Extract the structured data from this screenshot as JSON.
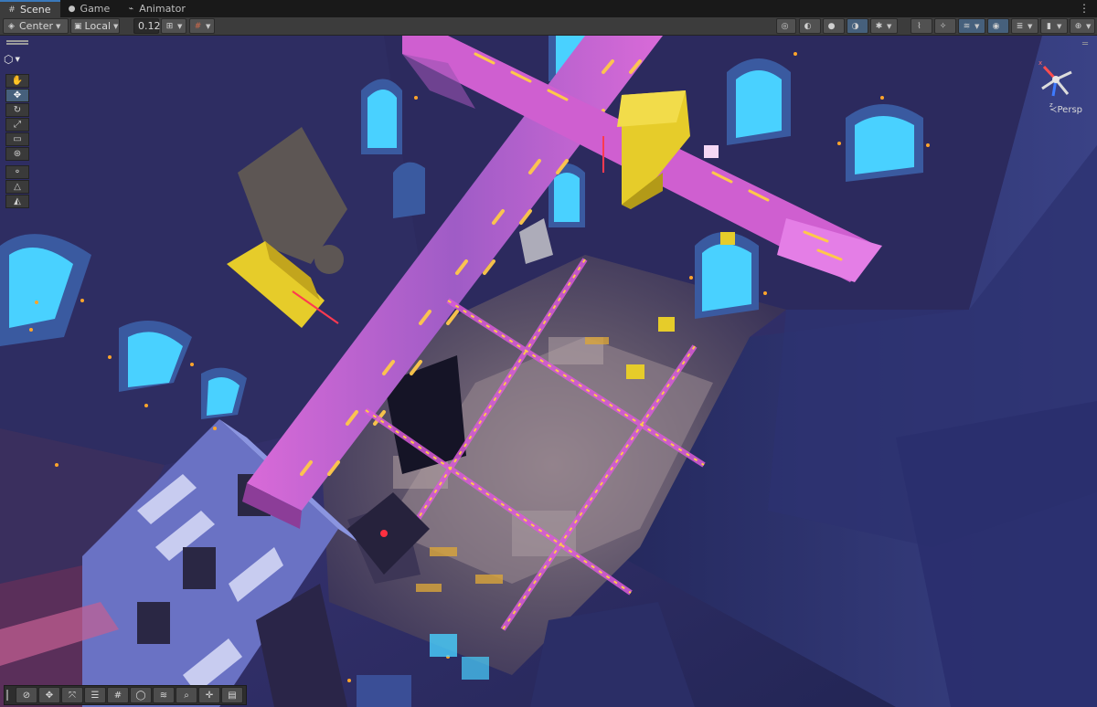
{
  "tabs": [
    {
      "label": "Scene",
      "icon": "grid-icon",
      "active": true
    },
    {
      "label": "Game",
      "icon": "gamepad-icon",
      "active": false
    },
    {
      "label": "Animator",
      "icon": "animator-icon",
      "active": false
    }
  ],
  "tab_menu": "⋮",
  "toolbar": {
    "pivot_mode": "Center",
    "pivot_rotation": "Local",
    "grid_snap_value": "0.125"
  },
  "view_orientation": "Persp",
  "tools": [
    "hand",
    "move",
    "rotate",
    "scale",
    "rect",
    "transform",
    "custom-a",
    "custom-b",
    "custom-c"
  ],
  "overlay_tools": [
    "compass",
    "move",
    "probuilder",
    "align",
    "grid",
    "sphere",
    "layers",
    "search",
    "crosshair",
    "panel"
  ],
  "colors": {
    "accent": "#46607c",
    "tab_underline": "#3a79bb",
    "scene_background": "#2a2a5a",
    "neon_pink": "#d95bd8",
    "neon_yellow": "#ffc94a",
    "window_cyan": "#49d1ff",
    "block_yellow": "#e6cc2a"
  }
}
